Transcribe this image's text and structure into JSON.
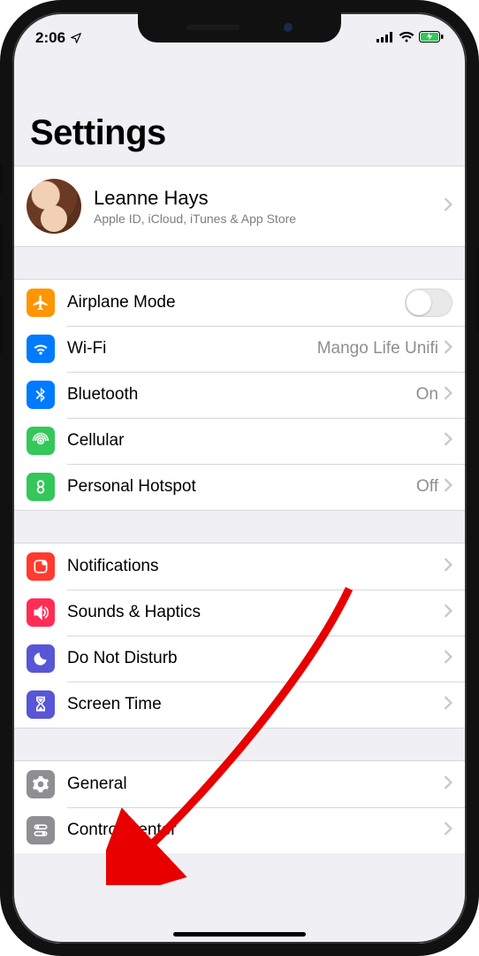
{
  "status": {
    "time": "2:06"
  },
  "title": "Settings",
  "profile": {
    "name": "Leanne Hays",
    "subtitle": "Apple ID, iCloud, iTunes & App Store"
  },
  "group1": {
    "airplane": {
      "label": "Airplane Mode",
      "color": "#ff9500"
    },
    "wifi": {
      "label": "Wi-Fi",
      "detail": "Mango Life Unifi",
      "color": "#007aff"
    },
    "bluetooth": {
      "label": "Bluetooth",
      "detail": "On",
      "color": "#007aff"
    },
    "cellular": {
      "label": "Cellular",
      "color": "#34c759"
    },
    "hotspot": {
      "label": "Personal Hotspot",
      "detail": "Off",
      "color": "#34c759"
    }
  },
  "group2": {
    "notifications": {
      "label": "Notifications",
      "color": "#ff3b30"
    },
    "sounds": {
      "label": "Sounds & Haptics",
      "color": "#ff2d55"
    },
    "dnd": {
      "label": "Do Not Disturb",
      "color": "#5856d6"
    },
    "screentime": {
      "label": "Screen Time",
      "color": "#5856d6"
    }
  },
  "group3": {
    "general": {
      "label": "General",
      "color": "#8e8e93"
    },
    "controlcenter": {
      "label": "Control Center",
      "color": "#8e8e93"
    }
  }
}
